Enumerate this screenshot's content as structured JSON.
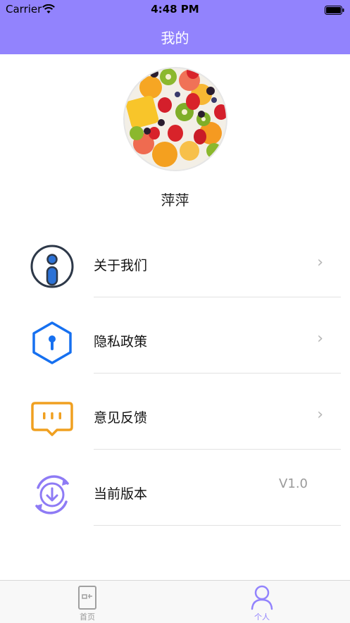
{
  "status_bar": {
    "carrier": "Carrier",
    "time": "4:48 PM"
  },
  "nav": {
    "title": "我的"
  },
  "profile": {
    "username": "萍萍"
  },
  "menu": [
    {
      "label": "关于我们",
      "icon": "info-icon",
      "color": "#2d3848",
      "chevron": "›"
    },
    {
      "label": "隐私政策",
      "icon": "shield-icon",
      "color": "#1670f0",
      "chevron": "›"
    },
    {
      "label": "意见反馈",
      "icon": "feedback-icon",
      "color": "#f0a020",
      "chevron": "›"
    },
    {
      "label": "当前版本",
      "icon": "download-icon",
      "color": "#8e7bf5",
      "value": "V1.0"
    }
  ],
  "tabs": [
    {
      "label": "首页",
      "icon": "home-icon",
      "active": false
    },
    {
      "label": "个人",
      "icon": "person-icon",
      "active": true
    }
  ],
  "colors": {
    "accent": "#9283fd",
    "tab_active": "#9283fd",
    "tab_inactive": "#999999"
  }
}
